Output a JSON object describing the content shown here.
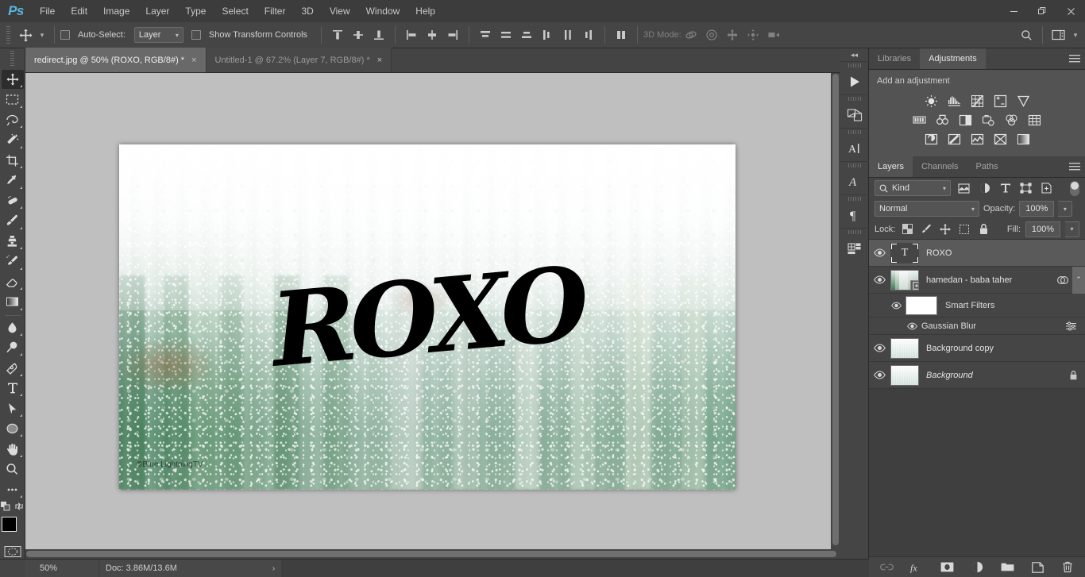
{
  "app": {
    "name": "Ps",
    "logo_color": "#5bb3e0",
    "menu": [
      "File",
      "Edit",
      "Image",
      "Layer",
      "Type",
      "Select",
      "Filter",
      "3D",
      "View",
      "Window",
      "Help"
    ],
    "window_controls": [
      "minimize",
      "restore",
      "close"
    ]
  },
  "options_bar": {
    "tool_icon": "move-tool-icon",
    "auto_select": {
      "label": "Auto-Select:",
      "checked": false,
      "value": "Layer"
    },
    "show_transform": {
      "label": "Show Transform Controls",
      "checked": false
    },
    "align_icons": [
      "align-top-edges-icon",
      "align-vertical-centers-icon",
      "align-bottom-edges-icon",
      "align-left-edges-icon",
      "align-horizontal-centers-icon",
      "align-right-edges-icon"
    ],
    "distribute_icons": [
      "distribute-top-edges-icon",
      "distribute-vertical-centers-icon",
      "distribute-bottom-edges-icon",
      "distribute-left-edges-icon",
      "distribute-horizontal-centers-icon",
      "distribute-right-edges-icon"
    ],
    "auto_align_icon": "auto-align-layers-icon",
    "three_d": {
      "label": "3D Mode:",
      "icons": [
        "3d-orbit-icon",
        "3d-roll-icon",
        "3d-pan-icon",
        "3d-slide-icon",
        "3d-scale-icon"
      ]
    },
    "search_icon": "search-icon",
    "workspace_icon": "workspace-switcher-icon"
  },
  "tabs": [
    {
      "title": "redirect.jpg @ 50% (ROXO, RGB/8#) *",
      "active": true,
      "close": "×"
    },
    {
      "title": "Untitled-1 @ 67.2% (Layer 7, RGB/8#) *",
      "active": false,
      "close": "×"
    }
  ],
  "toolbar": {
    "tools": [
      {
        "name": "move-tool",
        "selected": true
      },
      {
        "name": "rectangular-marquee-tool",
        "selected": false
      },
      {
        "name": "lasso-tool",
        "selected": false
      },
      {
        "name": "magic-wand-tool",
        "selected": false
      },
      {
        "name": "crop-tool",
        "selected": false
      },
      {
        "name": "eyedropper-tool",
        "selected": false
      },
      {
        "name": "spot-healing-brush-tool",
        "selected": false
      },
      {
        "name": "brush-tool",
        "selected": false
      },
      {
        "name": "clone-stamp-tool",
        "selected": false
      },
      {
        "name": "history-brush-tool",
        "selected": false
      },
      {
        "name": "eraser-tool",
        "selected": false
      },
      {
        "name": "gradient-tool",
        "selected": false
      },
      {
        "name": "blur-tool",
        "selected": false
      },
      {
        "name": "dodge-tool",
        "selected": false
      },
      {
        "name": "pen-tool",
        "selected": false
      },
      {
        "name": "horizontal-type-tool",
        "selected": false
      },
      {
        "name": "path-selection-tool",
        "selected": false
      },
      {
        "name": "ellipse-tool",
        "selected": false
      },
      {
        "name": "hand-tool",
        "selected": false
      },
      {
        "name": "zoom-tool",
        "selected": false
      },
      {
        "name": "edit-toolbar-tool",
        "selected": false
      }
    ],
    "foreground_color": "#000000",
    "background_color": "#e9e9e9",
    "quick_mask_icon": "quick-mask-icon"
  },
  "canvas": {
    "zoom_label": "50%",
    "artwork_text": "ROXO",
    "watermark": "©Blue LightningTV",
    "background_color": "#bfbfbf"
  },
  "mini_dock": {
    "collapse_icon": "collapse-panels-icon",
    "items": [
      {
        "name": "timeline-panel-icon",
        "glyph": "play"
      },
      {
        "name": "3d-panel-icon",
        "glyph": "cube"
      },
      {
        "name": "character-panel-icon",
        "glyph": "A|"
      },
      {
        "name": "character-styles-panel-icon",
        "glyph": "A"
      },
      {
        "name": "paragraph-panel-icon",
        "glyph": "¶"
      },
      {
        "name": "properties-panel-icon",
        "glyph": "props"
      }
    ]
  },
  "adjustments_panel": {
    "tabs": [
      {
        "label": "Libraries",
        "active": false
      },
      {
        "label": "Adjustments",
        "active": true
      }
    ],
    "menu_icon": "panel-menu-icon",
    "title": "Add an adjustment",
    "rows": [
      [
        "brightness-contrast-icon",
        "levels-icon",
        "curves-icon",
        "exposure-icon",
        "vibrance-icon"
      ],
      [
        "hue-saturation-icon",
        "color-balance-icon",
        "black-white-icon",
        "photo-filter-icon",
        "channel-mixer-icon",
        "color-lookup-icon"
      ],
      [
        "invert-icon",
        "posterize-icon",
        "threshold-icon",
        "selective-color-icon",
        "gradient-map-icon"
      ]
    ]
  },
  "layers_panel": {
    "tabs": [
      {
        "label": "Layers",
        "active": true
      },
      {
        "label": "Channels",
        "active": false
      },
      {
        "label": "Paths",
        "active": false
      }
    ],
    "menu_icon": "panel-menu-icon",
    "filter": {
      "kind_label": "Kind",
      "search_icon": "search-icon",
      "filter_icons": [
        "filter-pixel-icon",
        "filter-adjustment-icon",
        "filter-type-icon",
        "filter-shape-icon",
        "filter-smart-object-icon"
      ],
      "toggle_name": "filter-enable-toggle"
    },
    "blend_mode": "Normal",
    "opacity_label": "Opacity:",
    "opacity_value": "100%",
    "lock_label": "Lock:",
    "lock_icons": [
      "lock-transparent-pixels-icon",
      "lock-image-pixels-icon",
      "lock-position-icon",
      "lock-artboard-icon",
      "lock-all-icon"
    ],
    "fill_label": "Fill:",
    "fill_value": "100%",
    "layers": [
      {
        "name": "ROXO",
        "type": "text",
        "visible": true,
        "selected": true,
        "locked": false
      },
      {
        "name": "hamedan - baba taher",
        "type": "smart-object",
        "visible": true,
        "selected": false,
        "locked": false,
        "has_smart_filters": true
      },
      {
        "name": "Smart Filters",
        "type": "smart-filter-group",
        "visible": true,
        "indent": 1
      },
      {
        "name": "Gaussian Blur",
        "type": "smart-filter",
        "visible": true,
        "indent": 2
      },
      {
        "name": "Background copy",
        "type": "pixel",
        "visible": true,
        "selected": false,
        "locked": false
      },
      {
        "name": "Background",
        "type": "pixel",
        "visible": true,
        "selected": false,
        "locked": true,
        "italic": true
      }
    ],
    "footer_icons": [
      {
        "name": "link-layers-icon",
        "disabled": true
      },
      {
        "name": "layer-style-fx-icon",
        "disabled": false
      },
      {
        "name": "add-layer-mask-icon",
        "disabled": false
      },
      {
        "name": "new-adjustment-layer-icon",
        "disabled": false
      },
      {
        "name": "new-group-icon",
        "disabled": false
      },
      {
        "name": "new-layer-icon",
        "disabled": false
      },
      {
        "name": "delete-layer-icon",
        "disabled": false
      }
    ]
  },
  "status_bar": {
    "zoom": "50%",
    "doc_info": "Doc: 3.86M/13.6M",
    "arrow": "›"
  }
}
